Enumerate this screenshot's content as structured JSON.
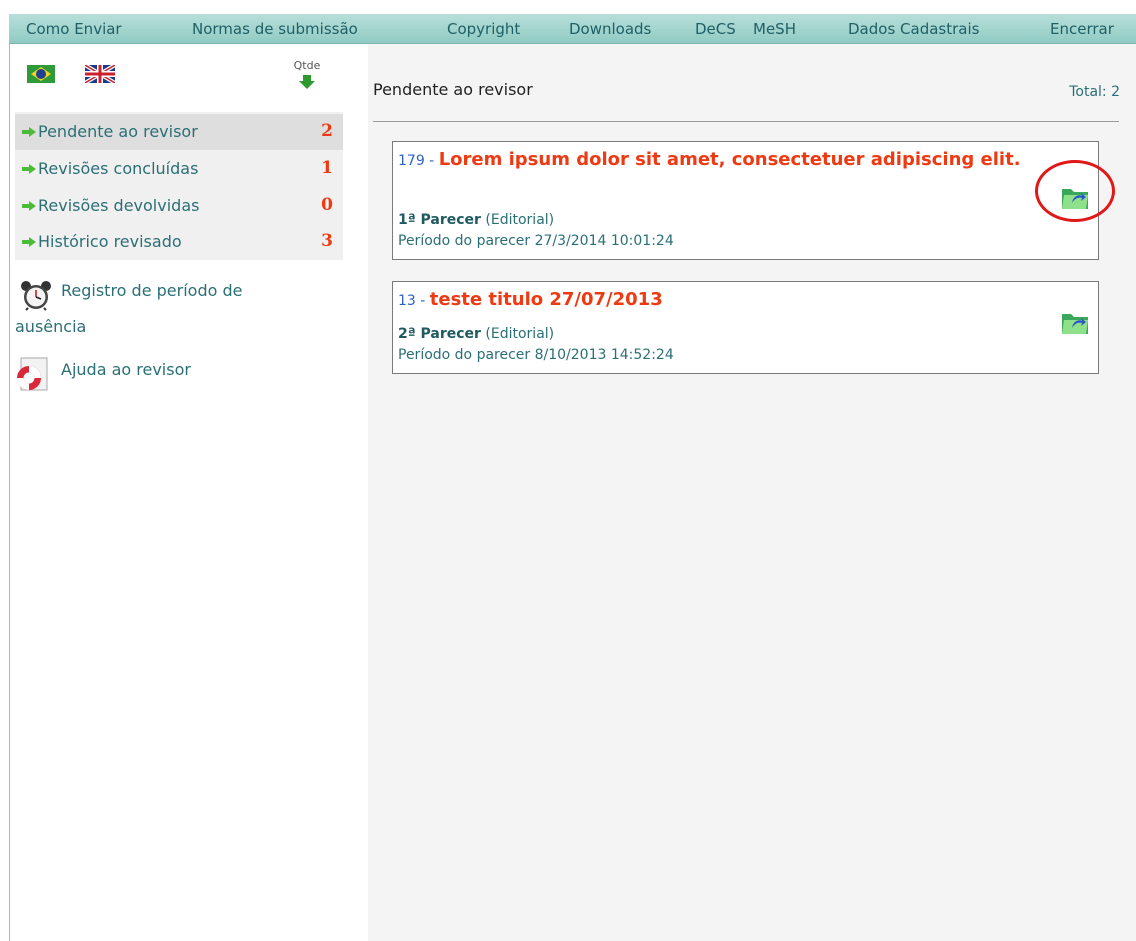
{
  "nav": {
    "items": [
      "Como Enviar",
      "Normas de submissão",
      "Copyright",
      "Downloads",
      "DeCS",
      "MeSH",
      "Dados Cadastrais",
      "Encerrar"
    ]
  },
  "sidebar": {
    "qtde_label": "Qtde",
    "menu": [
      {
        "label": "Pendente ao revisor",
        "count": "2"
      },
      {
        "label": "Revisões concluídas",
        "count": "1"
      },
      {
        "label": "Revisões devolvidas",
        "count": "0"
      },
      {
        "label": "Histórico revisado",
        "count": "3"
      }
    ],
    "links": {
      "absence_line1": "Registro de período de",
      "absence_line2": "ausência",
      "help": "Ajuda ao revisor"
    }
  },
  "main": {
    "title": "Pendente ao revisor",
    "total": "Total: 2",
    "cards": [
      {
        "number": "179",
        "separator": " - ",
        "title": "Lorem ipsum dolor sit amet, consectetuer adipiscing elit.",
        "parecer": "1ª Parecer",
        "parecer_type": "(Editorial)",
        "periodo": "Período do parecer 27/3/2014 10:01:24"
      },
      {
        "number": "13",
        "separator": " - ",
        "title": "teste titulo 27/07/2013",
        "parecer": "2ª Parecer",
        "parecer_type": "(Editorial)",
        "periodo": "Período do parecer 8/10/2013 14:52:24"
      }
    ]
  },
  "colors": {
    "nav_bg": "#a6d6cf",
    "link": "#2b6f76",
    "count": "#ee3a12",
    "title_red": "#ee3a12",
    "number_blue": "#2f62c4",
    "highlight": "#e01818"
  },
  "icons": [
    "brazil-flag-icon",
    "uk-flag-icon",
    "down-arrow-icon",
    "right-arrow-icon",
    "alarm-clock-icon",
    "lifebuoy-icon",
    "folder-icon"
  ]
}
